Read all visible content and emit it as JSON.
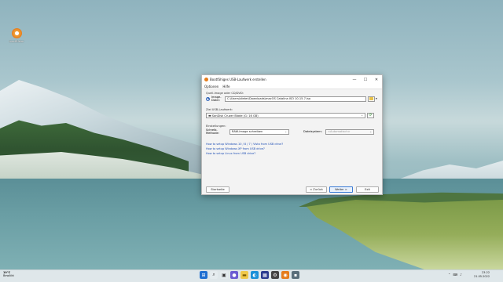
{
  "desktop": {
    "icons": [
      {
        "label": "mac8Ustar"
      }
    ]
  },
  "window": {
    "title": "Bootfähiges USB-Laufwerk erstellen",
    "controls": {
      "minimize": "—",
      "maximize": "☐",
      "close": "✕"
    },
    "menu": [
      "Optionen",
      "Hilfe"
    ],
    "source": {
      "group_label": "Quell-Image oder CD/DVD:",
      "radio_label": "Image-Datei:",
      "path": "C:\\Users\\dieter\\Downloads\\macOS Catalina ISO 10.15.7.iso"
    },
    "target": {
      "group_label": "Ziel USB-Laufwerk:",
      "drive": "SanDisk Cruzer Blade (G: 16 GB)"
    },
    "settings": {
      "group_label": "Einstellungen:",
      "write_method_label": "Schreib-Methode:",
      "write_method_value": "RAW-Image schreiben",
      "filesystem_label": "Dateisystem:",
      "filesystem_value": "<Automatisch>"
    },
    "links": [
      "How to setup Windows 10 / 8 / 7 / Vista from USB drive?",
      "How to setup Windows XP from USB drive?",
      "How to setup Linux from USB drive?"
    ],
    "buttons": {
      "start": "Startseite",
      "back": "< Zurück",
      "next": "Weiter >",
      "exit": "Exit"
    }
  },
  "taskbar": {
    "weather_temp": "19°C",
    "weather_text": "Bewölkt",
    "time": "23:22",
    "date": "21.05.2022"
  }
}
